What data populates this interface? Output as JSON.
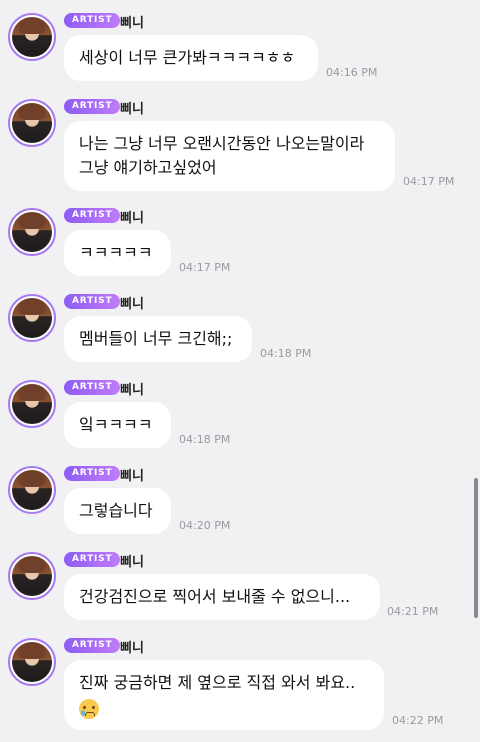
{
  "badge_label": "ARTIST",
  "artist_name": "삐니",
  "messages": [
    {
      "lines": [
        "세상이 너무 큰가봐ㅋㅋㅋㅋㅎㅎ"
      ],
      "time": "04:16 PM"
    },
    {
      "lines": [
        "나는 그냥 너무 오랜시간동안 나오는말이라",
        "그냥 얘기하고싶었어"
      ],
      "time": "04:17 PM"
    },
    {
      "lines": [
        "ㅋㅋㅋㅋㅋ"
      ],
      "time": "04:17 PM"
    },
    {
      "lines": [
        "멤버들이 너무 크긴해;;"
      ],
      "time": "04:18 PM"
    },
    {
      "lines": [
        "잌ㅋㅋㅋㅋ"
      ],
      "time": "04:18 PM"
    },
    {
      "lines": [
        "그렇습니다"
      ],
      "time": "04:20 PM"
    },
    {
      "lines": [
        "건강검진으로 찍어서 보내줄 수 없으니..."
      ],
      "time": "04:21 PM"
    },
    {
      "lines": [
        "진짜 궁금하면 제 옆으로 직접 와서 봐요.."
      ],
      "emoji": "crying-smile-emoji",
      "time": "04:22 PM"
    }
  ]
}
